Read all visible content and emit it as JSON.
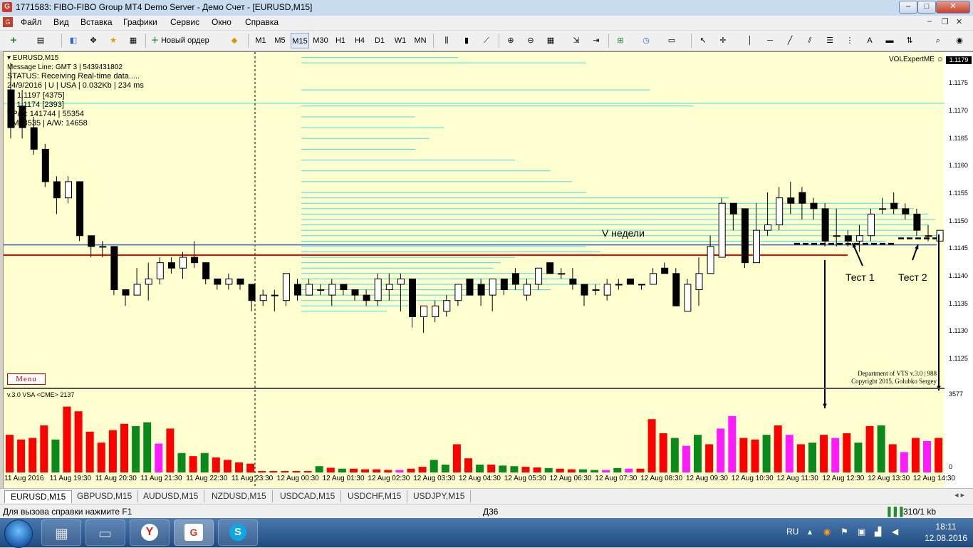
{
  "window": {
    "title": "1771583: FIBO-FIBO Group MT4 Demo Server - Демо Счет - [EURUSD,M15]",
    "app_icon": "G"
  },
  "menu": {
    "items": [
      "Файл",
      "Вид",
      "Вставка",
      "Графики",
      "Сервис",
      "Окно",
      "Справка"
    ]
  },
  "toolbar": {
    "new_order_label": "Новый ордер",
    "timeframes": [
      "M1",
      "M5",
      "M15",
      "M30",
      "H1",
      "H4",
      "D1",
      "W1",
      "MN"
    ],
    "selected_timeframe": "M15",
    "text_tool_label": "A"
  },
  "chart": {
    "symbol_header": "EURUSD,M15",
    "info_lines": [
      "Message Line: GMT 3  |  5439431802",
      "STATUS:  Receiving Real-time data.....",
      "24/9/2016 | U | USA | 0.032Kb | 234 ms",
      "D: 1.1197  [4375]",
      "S: 1.1174  [2393]",
      "VP/D: 141744 | 55354",
      "AM: 3535 | A/W: 14658"
    ],
    "expert_name": "VOLExpertME",
    "menu_button": "Menu",
    "copyright_line1": "Department of VTS  v.3.0 | 988",
    "copyright_line2": "Copyright 2015, Golubko Sergey",
    "annotation_volume": "V недели",
    "annotation_test1": "Тест 1",
    "annotation_test2": "Тест 2",
    "indicator_label": "v.3.0  VSA <CME>  2137",
    "indicator_max_label": "3577",
    "indicator_zero_label": "0",
    "price_labels": [
      "1.1175",
      "1.1170",
      "1.1165",
      "1.1160",
      "1.1155",
      "1.1150",
      "1.1145",
      "1.1140",
      "1.1135",
      "1.1130",
      "1.1125"
    ],
    "current_price": "1.1179",
    "time_labels": [
      "11 Aug 2016",
      "11 Aug 19:30",
      "11 Aug 20:30",
      "11 Aug 21:30",
      "11 Aug 22:30",
      "11 Aug 23:30",
      "12 Aug 00:30",
      "12 Aug 01:30",
      "12 Aug 02:30",
      "12 Aug 03:30",
      "12 Aug 04:30",
      "12 Aug 05:30",
      "12 Aug 06:30",
      "12 Aug 07:30",
      "12 Aug 08:30",
      "12 Aug 09:30",
      "12 Aug 10:30",
      "12 Aug 11:30",
      "12 Aug 12:30",
      "12 Aug 13:30",
      "12 Aug 14:30"
    ],
    "colors": {
      "background": "#ffffd0",
      "bull": "#ffffff",
      "bear": "#000000",
      "profile": "#40e0e0",
      "support_red": "#ff0000",
      "support_blue": "#3a5fcd",
      "vol_red": "#ff0000",
      "vol_green": "#0a8a1a",
      "vol_magenta": "#ff1aff"
    }
  },
  "chart_data": {
    "type": "candlestick",
    "ylim": [
      1.112,
      1.1182
    ],
    "candles": [
      [
        1.1175,
        1.118,
        1.1166,
        1.1168
      ],
      [
        1.1172,
        1.1175,
        1.1166,
        1.1168
      ],
      [
        1.1168,
        1.117,
        1.1163,
        1.1164
      ],
      [
        1.1164,
        1.1165,
        1.1157,
        1.1158
      ],
      [
        1.1158,
        1.1159,
        1.1152,
        1.1155
      ],
      [
        1.1155,
        1.1159,
        1.1154,
        1.1158
      ],
      [
        1.1158,
        1.1158,
        1.1147,
        1.1148
      ],
      [
        1.1148,
        1.1148,
        1.1144,
        1.1146
      ],
      [
        1.1146,
        1.1147,
        1.1144,
        1.1146
      ],
      [
        1.1146,
        1.1146,
        1.1137,
        1.1138
      ],
      [
        1.1138,
        1.1138,
        1.1135,
        1.1137
      ],
      [
        1.1137,
        1.1142,
        1.1137,
        1.1139
      ],
      [
        1.1139,
        1.1143,
        1.1136,
        1.114
      ],
      [
        1.114,
        1.1144,
        1.1139,
        1.1143
      ],
      [
        1.1143,
        1.1144,
        1.1141,
        1.1142
      ],
      [
        1.1142,
        1.1145,
        1.114,
        1.1144
      ],
      [
        1.1144,
        1.1147,
        1.1142,
        1.1143
      ],
      [
        1.1143,
        1.1143,
        1.1139,
        1.114
      ],
      [
        1.114,
        1.114,
        1.1138,
        1.1139
      ],
      [
        1.1139,
        1.1141,
        1.1138,
        1.114
      ],
      [
        1.114,
        1.114,
        1.1138,
        1.1139
      ],
      [
        1.1139,
        1.1139,
        1.1134,
        1.1136
      ],
      [
        1.1136,
        1.1138,
        1.1135,
        1.1137
      ],
      [
        1.1137,
        1.1138,
        1.1134,
        1.1137
      ],
      [
        1.1136,
        1.1141,
        1.1135,
        1.1141
      ],
      [
        1.1139,
        1.114,
        1.1136,
        1.1137
      ],
      [
        1.1137,
        1.114,
        1.1137,
        1.1139
      ],
      [
        1.1138,
        1.1139,
        1.1137,
        1.1138
      ],
      [
        1.1137,
        1.114,
        1.1135,
        1.1139
      ],
      [
        1.1139,
        1.1139,
        1.1137,
        1.1138
      ],
      [
        1.1138,
        1.1138,
        1.1136,
        1.1137
      ],
      [
        1.1137,
        1.1138,
        1.1135,
        1.1136
      ],
      [
        1.1136,
        1.1141,
        1.1135,
        1.114
      ],
      [
        1.1138,
        1.1141,
        1.1136,
        1.1139
      ],
      [
        1.1139,
        1.1141,
        1.1134,
        1.114
      ],
      [
        1.114,
        1.114,
        1.1131,
        1.1133
      ],
      [
        1.1133,
        1.1135,
        1.113,
        1.1135
      ],
      [
        1.1133,
        1.1136,
        1.1132,
        1.1135
      ],
      [
        1.1134,
        1.1137,
        1.1133,
        1.1136
      ],
      [
        1.1136,
        1.1139,
        1.1135,
        1.1139
      ],
      [
        1.114,
        1.114,
        1.1137,
        1.1137
      ],
      [
        1.1139,
        1.114,
        1.1135,
        1.1137
      ],
      [
        1.1137,
        1.114,
        1.1134,
        1.114
      ],
      [
        1.114,
        1.114,
        1.1137,
        1.1138
      ],
      [
        1.1141,
        1.1142,
        1.1138,
        1.1139
      ],
      [
        1.1137,
        1.114,
        1.1136,
        1.1139
      ],
      [
        1.1139,
        1.1142,
        1.1138,
        1.1142
      ],
      [
        1.1143,
        1.1143,
        1.1141,
        1.1141
      ],
      [
        1.1141,
        1.1142,
        1.114,
        1.1141
      ],
      [
        1.114,
        1.1142,
        1.1138,
        1.1139
      ],
      [
        1.1139,
        1.1139,
        1.1135,
        1.1137
      ],
      [
        1.1138,
        1.1139,
        1.1137,
        1.1138
      ],
      [
        1.1137,
        1.114,
        1.1136,
        1.1139
      ],
      [
        1.1139,
        1.114,
        1.1138,
        1.1139
      ],
      [
        1.114,
        1.114,
        1.1139,
        1.1139
      ],
      [
        1.1139,
        1.1139,
        1.1138,
        1.1139
      ],
      [
        1.1139,
        1.1142,
        1.1139,
        1.1141
      ],
      [
        1.1142,
        1.1143,
        1.1141,
        1.1141
      ],
      [
        1.1141,
        1.1142,
        1.1135,
        1.1135
      ],
      [
        1.1134,
        1.114,
        1.1134,
        1.1139
      ],
      [
        1.1138,
        1.1144,
        1.1135,
        1.1141
      ],
      [
        1.1141,
        1.1148,
        1.1141,
        1.1146
      ],
      [
        1.1144,
        1.1155,
        1.1144,
        1.1154
      ],
      [
        1.1154,
        1.1154,
        1.1149,
        1.1152
      ],
      [
        1.1153,
        1.1153,
        1.1142,
        1.1143
      ],
      [
        1.1143,
        1.1154,
        1.1143,
        1.1149
      ],
      [
        1.1149,
        1.1156,
        1.1148,
        1.115
      ],
      [
        1.115,
        1.1157,
        1.1149,
        1.1155
      ],
      [
        1.1155,
        1.1158,
        1.1152,
        1.1154
      ],
      [
        1.1156,
        1.1157,
        1.1151,
        1.1154
      ],
      [
        1.1154,
        1.1155,
        1.1151,
        1.1153
      ],
      [
        1.1153,
        1.1154,
        1.1146,
        1.1147
      ],
      [
        1.1148,
        1.1153,
        1.1146,
        1.1148
      ],
      [
        1.1148,
        1.1149,
        1.1146,
        1.1147
      ],
      [
        1.1147,
        1.115,
        1.1145,
        1.1148
      ],
      [
        1.1148,
        1.1153,
        1.1147,
        1.1152
      ],
      [
        1.1153,
        1.1155,
        1.1152,
        1.1153
      ],
      [
        1.1154,
        1.1156,
        1.1152,
        1.1153
      ],
      [
        1.1153,
        1.1154,
        1.1151,
        1.1152
      ],
      [
        1.1152,
        1.1153,
        1.1148,
        1.1149
      ],
      [
        1.1148,
        1.115,
        1.1147,
        1.1148
      ],
      [
        1.1147,
        1.1149,
        1.1147,
        1.1149
      ],
      [
        1.1149,
        1.1158,
        1.1149,
        1.1156
      ]
    ],
    "volume": [
      [
        120,
        "r"
      ],
      [
        105,
        "r"
      ],
      [
        110,
        "r"
      ],
      [
        150,
        "r"
      ],
      [
        105,
        "g"
      ],
      [
        210,
        "r"
      ],
      [
        195,
        "r"
      ],
      [
        130,
        "r"
      ],
      [
        95,
        "r"
      ],
      [
        135,
        "r"
      ],
      [
        155,
        "r"
      ],
      [
        148,
        "g"
      ],
      [
        160,
        "g"
      ],
      [
        92,
        "m"
      ],
      [
        140,
        "r"
      ],
      [
        62,
        "g"
      ],
      [
        52,
        "r"
      ],
      [
        62,
        "g"
      ],
      [
        48,
        "r"
      ],
      [
        40,
        "r"
      ],
      [
        32,
        "r"
      ],
      [
        28,
        "r"
      ],
      [
        30,
        "g"
      ],
      [
        35,
        "r"
      ],
      [
        0,
        "r"
      ],
      [
        0,
        "r"
      ],
      [
        0,
        "r"
      ],
      [
        0,
        "r"
      ],
      [
        0,
        "r"
      ],
      [
        20,
        "g"
      ],
      [
        15,
        "r"
      ],
      [
        12,
        "g"
      ],
      [
        12,
        "r"
      ],
      [
        10,
        "r"
      ],
      [
        10,
        "r"
      ],
      [
        8,
        "r"
      ],
      [
        8,
        "m"
      ],
      [
        12,
        "r"
      ],
      [
        18,
        "r"
      ],
      [
        40,
        "g"
      ],
      [
        25,
        "g"
      ],
      [
        90,
        "r"
      ],
      [
        45,
        "r"
      ],
      [
        25,
        "g"
      ],
      [
        25,
        "r"
      ],
      [
        22,
        "g"
      ],
      [
        20,
        "g"
      ],
      [
        18,
        "r"
      ],
      [
        16,
        "r"
      ],
      [
        14,
        "g"
      ],
      [
        12,
        "r"
      ],
      [
        10,
        "r"
      ],
      [
        10,
        "g"
      ],
      [
        8,
        "g"
      ],
      [
        8,
        "m"
      ],
      [
        14,
        "g"
      ],
      [
        12,
        "m"
      ],
      [
        12,
        "r"
      ],
      [
        12,
        "g"
      ],
      [
        8,
        "r"
      ],
      [
        10,
        "r"
      ],
      [
        45,
        "g"
      ],
      [
        40,
        "r"
      ],
      [
        32,
        "m"
      ],
      [
        40,
        "g"
      ],
      [
        55,
        "r"
      ],
      [
        60,
        "r"
      ],
      [
        60,
        "r"
      ],
      [
        60,
        "g"
      ],
      [
        62,
        "m"
      ],
      [
        45,
        "r"
      ],
      [
        45,
        "m"
      ],
      [
        0,
        "r"
      ],
      [
        0,
        "r"
      ],
      [
        0,
        "r"
      ],
      [
        0,
        "r"
      ],
      [
        0,
        "r"
      ],
      [
        0,
        "r"
      ],
      [
        0,
        "r"
      ],
      [
        0,
        "r"
      ],
      [
        0,
        "r"
      ],
      [
        0,
        "r"
      ],
      [
        0,
        "r"
      ],
      [
        0,
        "r"
      ]
    ],
    "volume_tail": [
      [
        18,
        "g"
      ],
      [
        16,
        "r"
      ],
      [
        40,
        "g"
      ],
      [
        30,
        "g"
      ],
      [
        22,
        "g"
      ],
      [
        35,
        "m"
      ],
      [
        25,
        "r"
      ],
      [
        14,
        "m"
      ],
      [
        45,
        "g"
      ],
      [
        60,
        "r"
      ],
      [
        70,
        "r"
      ],
      [
        80,
        "g"
      ],
      [
        100,
        "r"
      ],
      [
        135,
        "g"
      ],
      [
        160,
        "g"
      ],
      [
        155,
        "g"
      ],
      [
        170,
        "r"
      ],
      [
        125,
        "r"
      ],
      [
        110,
        "g"
      ],
      [
        85,
        "m"
      ],
      [
        120,
        "g"
      ],
      [
        90,
        "r"
      ],
      [
        140,
        "m"
      ],
      [
        180,
        "m"
      ],
      [
        110,
        "r"
      ],
      [
        105,
        "r"
      ],
      [
        120,
        "g"
      ],
      [
        150,
        "r"
      ],
      [
        120,
        "m"
      ],
      [
        90,
        "r"
      ],
      [
        95,
        "g"
      ],
      [
        120,
        "r"
      ],
      [
        110,
        "m"
      ],
      [
        125,
        "r"
      ],
      [
        95,
        "g"
      ],
      [
        148,
        "r"
      ],
      [
        150,
        "g"
      ],
      [
        90,
        "r"
      ],
      [
        65,
        "m"
      ],
      [
        110,
        "r"
      ],
      [
        100,
        "m"
      ],
      [
        110,
        "r"
      ],
      [
        240,
        "g"
      ]
    ],
    "profile_levels": [
      [
        1.1181,
        220
      ],
      [
        1.118,
        400
      ],
      [
        1.1175,
        490
      ],
      [
        1.1172,
        550
      ],
      [
        1.117,
        160
      ],
      [
        1.1168,
        200
      ],
      [
        1.1166,
        180
      ],
      [
        1.1164,
        160
      ],
      [
        1.1162,
        300
      ],
      [
        1.116,
        350
      ],
      [
        1.1158,
        380
      ],
      [
        1.1156,
        400
      ],
      [
        1.1155,
        600
      ],
      [
        1.1154,
        840
      ],
      [
        1.1153,
        860
      ],
      [
        1.1152,
        880
      ],
      [
        1.1151,
        890
      ],
      [
        1.115,
        880
      ],
      [
        1.1149,
        860
      ],
      [
        1.1148,
        900
      ],
      [
        1.1147,
        820
      ],
      [
        1.1146,
        400
      ],
      [
        1.1145,
        420
      ],
      [
        1.1144,
        300
      ],
      [
        1.1143,
        280
      ],
      [
        1.1142,
        270
      ],
      [
        1.1141,
        360
      ],
      [
        1.114,
        380
      ],
      [
        1.1139,
        420
      ],
      [
        1.1138,
        350
      ],
      [
        1.1137,
        240
      ],
      [
        1.1136,
        200
      ],
      [
        1.1135,
        160
      ],
      [
        1.1134,
        120
      ]
    ],
    "support_red_price": 1.11444,
    "support_blue_price": 1.11463
  },
  "tabs": [
    "EURUSD,M15",
    "GBPUSD,M15",
    "AUDUSD,M15",
    "NZDUSD,M15",
    "USDCAD,M15",
    "USDCHF,M15",
    "USDJPY,M15"
  ],
  "statusbar": {
    "help_text": "Для вызова справки нажмите F1",
    "profile_name": "Д36",
    "traffic": "310/1 kb"
  },
  "taskbar": {
    "lang": "RU",
    "time": "18:11",
    "date": "12.08.2016",
    "apps": [
      "calculator-app",
      "computer-app",
      "yandex-browser-app",
      "fibogroup-app",
      "skype-app"
    ]
  }
}
